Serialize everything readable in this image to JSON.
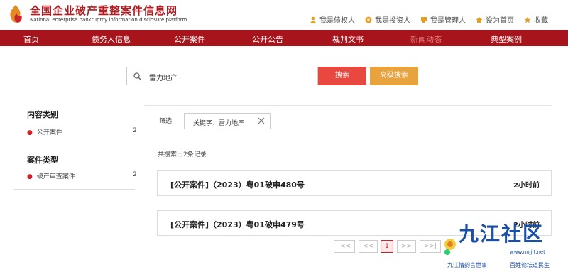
{
  "header": {
    "site_title": "全国企业破产重整案件信息网",
    "site_subtitle": "National enterprise bankruptcy  information disclosure platform",
    "top_links": [
      {
        "label": "我是债权人",
        "icon": "person-icon"
      },
      {
        "label": "我是投资人",
        "icon": "coin-icon"
      },
      {
        "label": "我是管理人",
        "icon": "manager-icon"
      },
      {
        "label": "设为首页",
        "icon": "home-icon"
      },
      {
        "label": "收藏",
        "icon": "star-icon"
      }
    ]
  },
  "nav": {
    "items": [
      "首页",
      "债务人信息",
      "公开案件",
      "公开公告",
      "裁判文书",
      "新闻动态",
      "典型案例"
    ],
    "active_index": 5
  },
  "search": {
    "value": "雷力地产",
    "search_label": "搜索",
    "advanced_label": "高级搜索"
  },
  "sidebar": {
    "sections": [
      {
        "title": "内容类别",
        "items": [
          {
            "label": "公开案件",
            "count": "2"
          }
        ]
      },
      {
        "title": "案件类型",
        "items": [
          {
            "label": "破产审查案件",
            "count": "2"
          }
        ]
      }
    ]
  },
  "filter": {
    "label": "筛选",
    "tag": "关键字：雷力地产"
  },
  "results": {
    "count_text": "共搜索出2条记录",
    "items": [
      {
        "title": "[公开案件]（2023）粤01破申480号",
        "time": "2小时前"
      },
      {
        "title": "[公开案件]（2023）粤01破申479号",
        "time": "2小时前"
      }
    ]
  },
  "pager": {
    "first": "|<<",
    "prev": "<<",
    "current": "1",
    "next": ">>",
    "last": ">>|"
  },
  "watermark": {
    "brand": "九江社区",
    "url": "www.nnjjlt.net",
    "slogan_left": "九江情韵言世事",
    "slogan_right": "百姓论坛道民生"
  },
  "colors": {
    "brand_red": "#a8141b",
    "search_red": "#e8483f",
    "advanced_orange": "#e8a33c"
  }
}
